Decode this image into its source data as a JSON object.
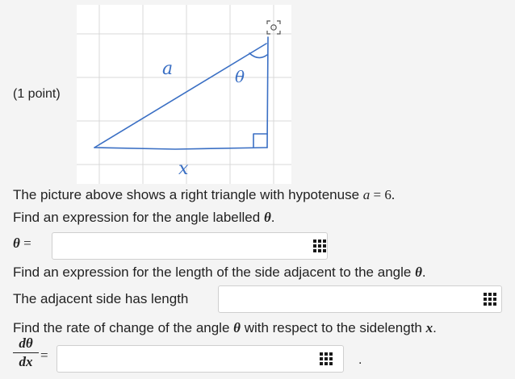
{
  "points_label": "(1 point)",
  "figure": {
    "label_a": "a",
    "label_theta": "θ",
    "label_x": "x",
    "corner_icon": "camera-viewfinder-icon"
  },
  "text": {
    "intro_prefix": "The picture above shows a right triangle with hypotenuse ",
    "intro_var": "a",
    "intro_eq": " = 6.",
    "find_angle_prefix": "Find an expression for the angle labelled ",
    "find_angle_var": "θ",
    "find_angle_suffix": ".",
    "theta_eq_var": "θ",
    "theta_eq_sign": " =",
    "find_adj_prefix": "Find an expression for the length of the side adjacent to the angle ",
    "find_adj_var": "θ",
    "find_adj_suffix": ".",
    "adj_label": "The adjacent side has length",
    "rate_prefix": "Find the rate of change of the angle ",
    "rate_var1": "θ",
    "rate_mid": " with respect to the sidelength ",
    "rate_var2": "x",
    "rate_suffix": ".",
    "deriv_num": "dθ",
    "deriv_den": "dx",
    "deriv_eq": "=",
    "period": "."
  },
  "inputs": {
    "theta_value": "",
    "adjacent_value": "",
    "rate_value": ""
  },
  "icons": {
    "answer_palette": "grid-icon"
  },
  "colors": {
    "ink": "#3a6fc4",
    "grid": "#d9d9d9",
    "icon": "#1a1a1a"
  }
}
